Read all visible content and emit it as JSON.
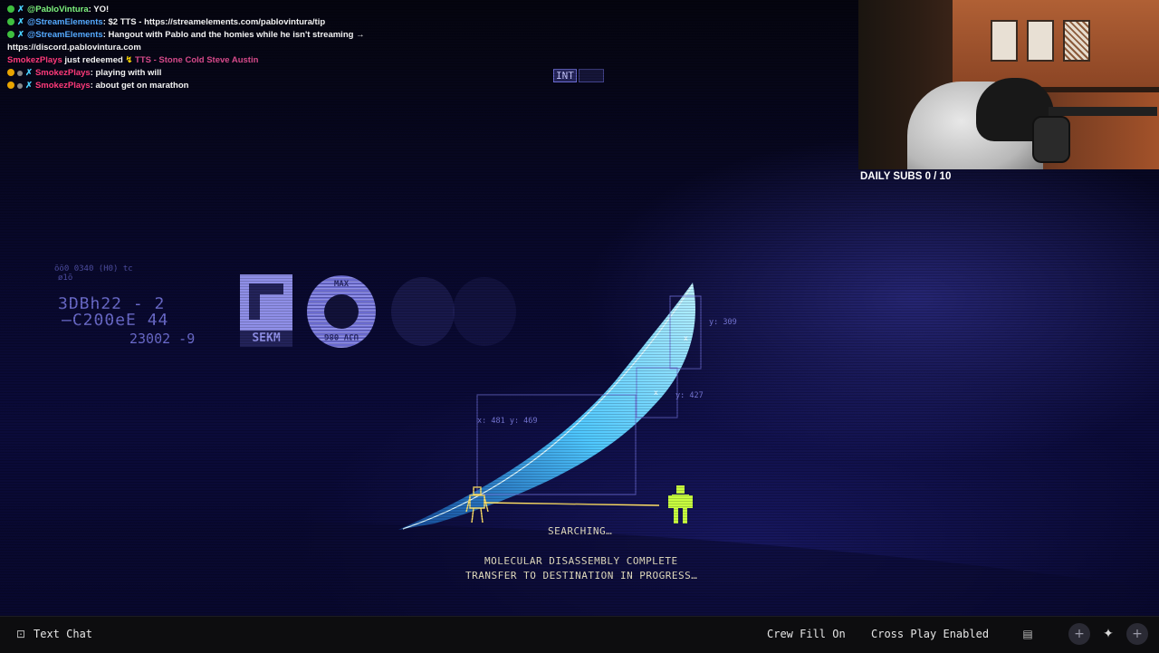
{
  "chat": [
    {
      "badges": [
        "green",
        "sword"
      ],
      "user": "@PabloVintura",
      "user_color": "green",
      "message": "YO!"
    },
    {
      "badges": [
        "green",
        "sword"
      ],
      "user": "@StreamElements",
      "user_color": "blue",
      "message": "$2 TTS - https://streamelements.com/pablovintura/tip"
    },
    {
      "badges": [
        "green",
        "sword"
      ],
      "user": "@StreamElements",
      "user_color": "blue",
      "message": "Hangout with Pablo and the homies while he isn't streaming →"
    },
    {
      "badges": [],
      "user": "",
      "user_color": "",
      "message": "https://discord.pablovintura.com"
    },
    {
      "badges": [],
      "user": "SmokezPlays",
      "user_color": "pink",
      "message": "just redeemed",
      "tts": "TTS - Stone Cold Steve Austin"
    },
    {
      "badges": [
        "orange",
        "grey",
        "sword"
      ],
      "user": "SmokezPlays",
      "user_color": "pink",
      "message": ": playing with will"
    },
    {
      "badges": [
        "orange",
        "grey",
        "sword"
      ],
      "user": "SmokezPlays",
      "user_color": "pink",
      "message": ": about get on marathon"
    }
  ],
  "hud": {
    "int_tag": "INT",
    "code_line1": "3DBh22 - 2",
    "code_line2": "C200eE 44",
    "code_line3": "23002 -9",
    "tiny_top": "0340 (H0) tc",
    "sekm_label": "SEKM",
    "dial_top": "MAX",
    "dial_bottom": "UJV 08G",
    "coord_main": "x: 481  y: 469",
    "coord_top": "y: 309",
    "coord_mid": "y: 427"
  },
  "status": {
    "searching": "SEARCHING…",
    "line1": "MOLECULAR DISASSEMBLY COMPLETE",
    "line2": "TRANSFER TO DESTINATION IN PROGRESS…"
  },
  "stream": {
    "daily_subs": "DAILY SUBS 0 / 10"
  },
  "bottombar": {
    "text_chat": "Text Chat",
    "crew_fill": "Crew Fill On",
    "cross_play": "Cross Play Enabled"
  },
  "icons": {
    "chat_icon": "chat-icon",
    "message_icon": "message-icon",
    "plus_icon": "plus-icon",
    "crew_icon": "crew-icon"
  },
  "colors": {
    "hud_purple": "#8f8fe8",
    "feather_cyan": "#4fc8ff",
    "runner_green": "#c8ff40",
    "beam_yellow": "#ffe066"
  }
}
